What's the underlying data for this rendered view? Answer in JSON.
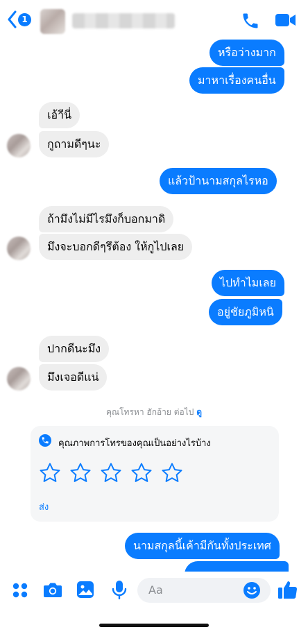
{
  "header": {
    "unread_count": "1",
    "contact_name": ""
  },
  "messages": [
    {
      "side": "out",
      "text": "หรือว่างมาก"
    },
    {
      "side": "out",
      "text": "มาหาเรื่องคนอื่น"
    },
    {
      "side": "in",
      "text": "เอ้าีนี่"
    },
    {
      "side": "in",
      "text": "กูถามดีๆนะ"
    },
    {
      "side": "out",
      "text": "แล้วป้านามสกุลไรหอ"
    },
    {
      "side": "in",
      "text": "ถ้ามึงไม่มีไรมึงก็บอกมาดิ"
    },
    {
      "side": "in",
      "text": "มึงจะบอกดีๆรึต้อง ให้กูไปเลย"
    },
    {
      "side": "out",
      "text": "ไปทำไมเลย"
    },
    {
      "side": "out",
      "text": "อยู่ชัยภูมิหนิ"
    },
    {
      "side": "in",
      "text": "ปากดีนะมึง"
    },
    {
      "side": "in",
      "text": "มึงเจอดีแน่"
    },
    {
      "side": "out",
      "text": "นามสกุลนี้เค้ามีกันทั้งประเทศ"
    }
  ],
  "call_notice": {
    "text": "คุณโทรหา ฮักอ้าย ต่อไป",
    "link": "ดู"
  },
  "rating_card": {
    "title": "คุณภาพการโทรของคุณเป็นอย่างไรบ้าง",
    "stars": 5,
    "submit_label": "ส่ง"
  },
  "composer": {
    "placeholder": "Aa"
  },
  "colors": {
    "accent": "#0a7cff",
    "incoming_bubble": "#eeeeee"
  },
  "icons": [
    "back-chevron-icon",
    "phone-icon",
    "video-camera-icon",
    "apps-icon",
    "camera-icon",
    "gallery-icon",
    "microphone-icon",
    "emoji-icon",
    "thumbs-up-icon",
    "phone-circle-icon",
    "star-icon"
  ]
}
